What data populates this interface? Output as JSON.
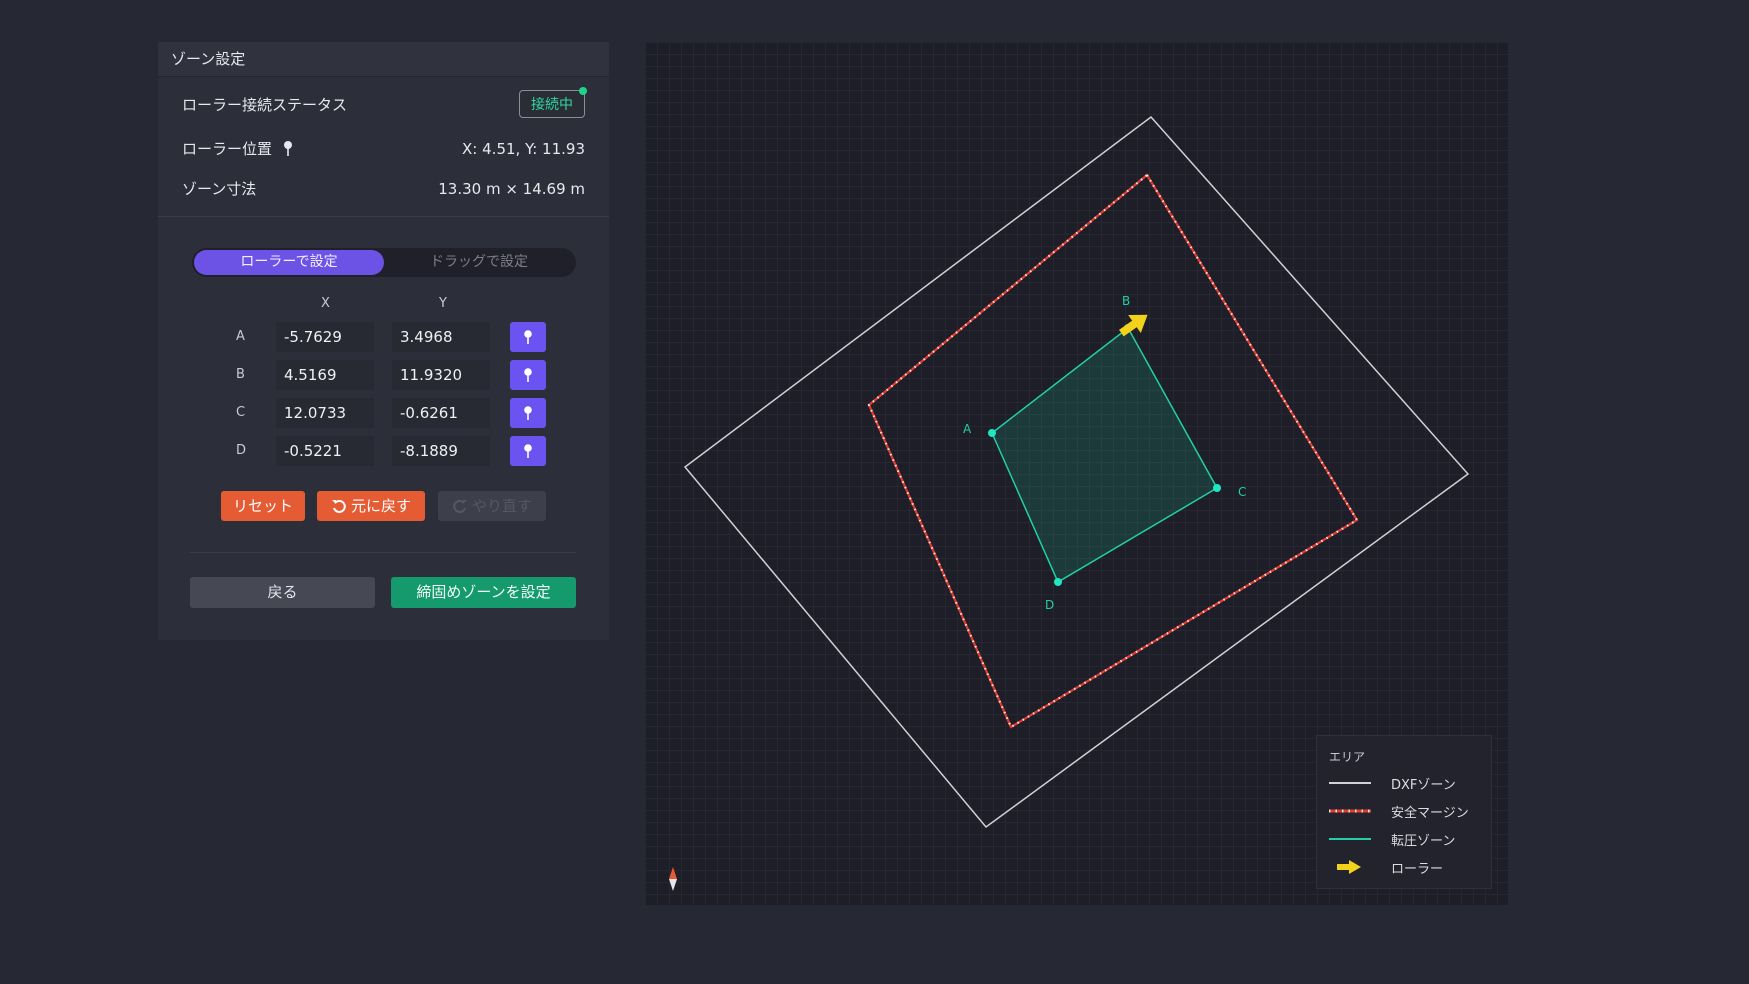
{
  "panel": {
    "title": "ゾーン設定",
    "status_label": "ローラー接続ステータス",
    "status_value": "接続中",
    "position_label": "ローラー位置",
    "position_value": "X: 4.51, Y: 11.93",
    "size_label": "ゾーン寸法",
    "size_value": "13.30 m × 14.69 m"
  },
  "mode_toggle": {
    "roller": "ローラーで設定",
    "drag": "ドラッグで設定",
    "selected": "ローラーで設定"
  },
  "table": {
    "x_header": "X",
    "y_header": "Y",
    "points": [
      {
        "label": "A",
        "x": "-5.7629",
        "y": "3.4968"
      },
      {
        "label": "B",
        "x": "4.5169",
        "y": "11.9320"
      },
      {
        "label": "C",
        "x": "12.0733",
        "y": "-0.6261"
      },
      {
        "label": "D",
        "x": "-0.5221",
        "y": "-8.1889"
      }
    ]
  },
  "actions": {
    "reset": "リセット",
    "undo": "元に戻す",
    "redo": "やり直す"
  },
  "footer": {
    "back": "戻る",
    "set_zone": "締固めゾーンを設定"
  },
  "map": {
    "labels": {
      "A": "A",
      "B": "B",
      "C": "C",
      "D": "D"
    }
  },
  "legend": {
    "title": "エリア",
    "items": [
      {
        "label": "DXFゾーン",
        "color": "#d0d0d6"
      },
      {
        "label": "安全マージン",
        "color": "#e53a2e"
      },
      {
        "label": "転圧ゾーン",
        "color": "#22cfa8"
      },
      {
        "label": "ローラー",
        "color": "#f2d21b"
      }
    ]
  },
  "colors": {
    "accent": "#6d52e6",
    "danger": "#e55b34",
    "success": "#149a6c",
    "status": "#2fd9a1"
  }
}
